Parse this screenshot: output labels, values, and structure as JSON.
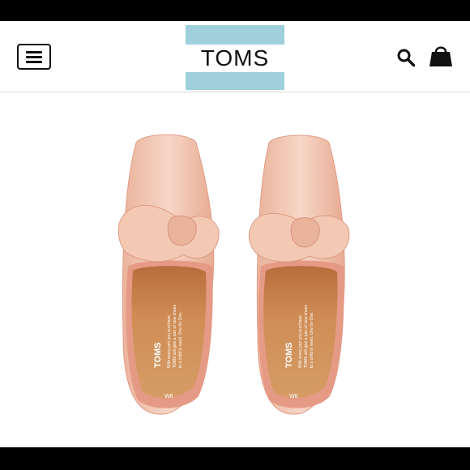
{
  "header": {
    "brand": "TOMS",
    "menu_icon": "hamburger-menu-icon",
    "search_icon": "search-icon",
    "cart_icon": "shopping-bag-icon"
  },
  "product": {
    "insole_brand": "TOMS",
    "insole_line1": "With every pair you purchase,",
    "insole_line2": "TOMS will give a pair of new shoes",
    "insole_line3": "to a child in need. One for One.",
    "size": "W6",
    "colors": {
      "upper": "#f1c4ae",
      "insole": "#c9834e",
      "lining": "#e59a86"
    }
  }
}
